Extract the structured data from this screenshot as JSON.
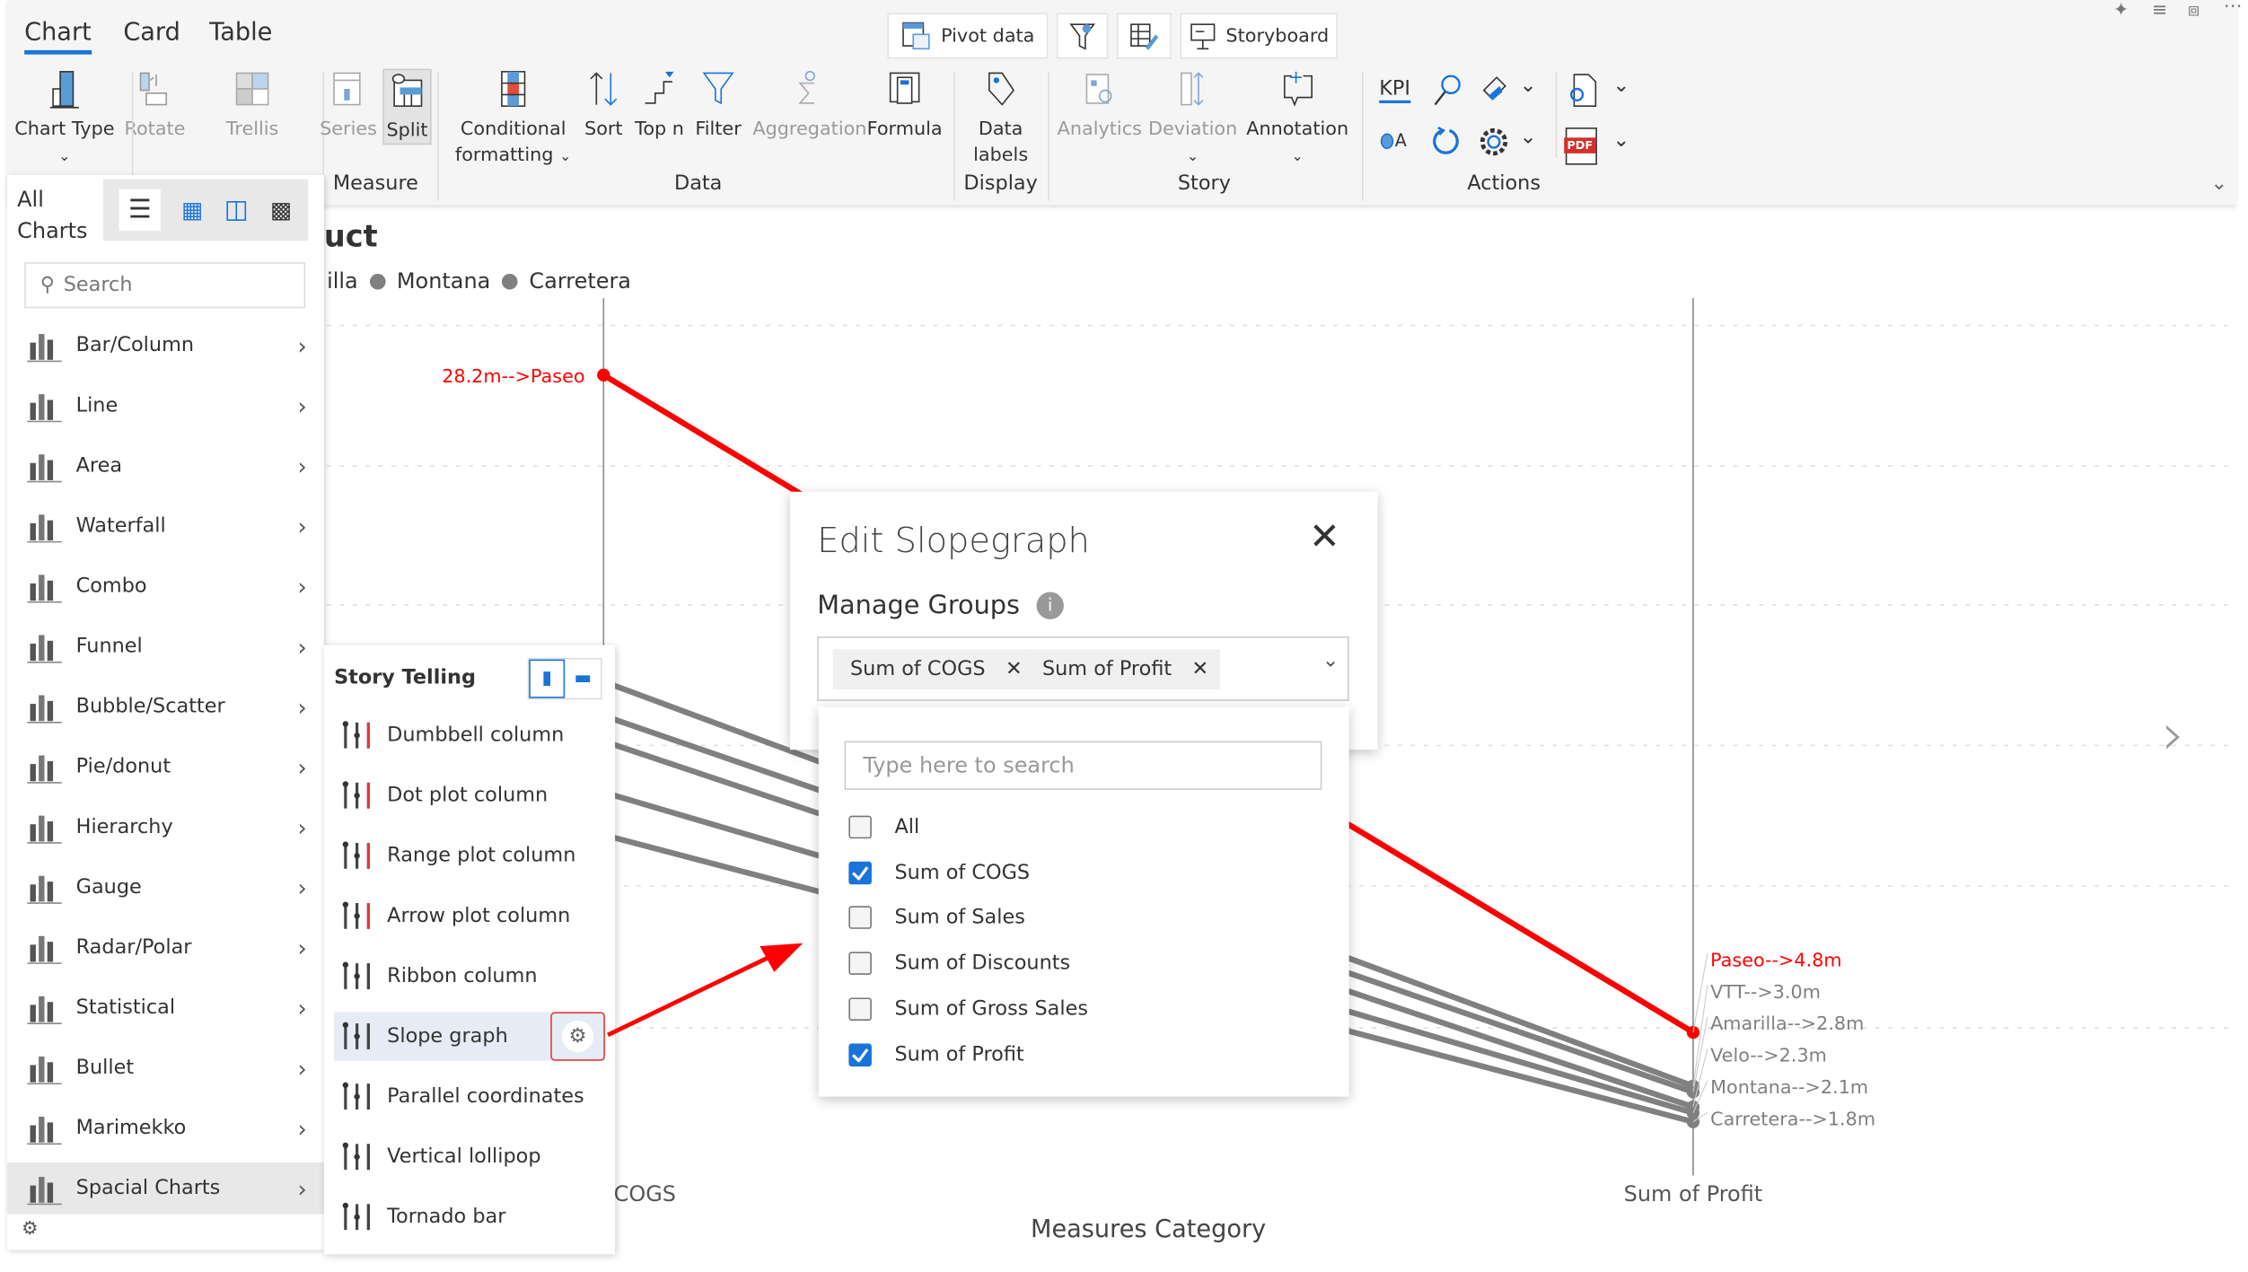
{
  "ribbon": {
    "tabs": [
      {
        "label": "Chart",
        "active": true
      },
      {
        "label": "Card"
      },
      {
        "label": "Table"
      }
    ],
    "top_buttons": {
      "pivot": "Pivot data",
      "storyboard": "Storyboard"
    },
    "buttons": {
      "chart_type": "Chart Type",
      "rotate": "Rotate",
      "trellis": "Trellis",
      "series": "Series",
      "split": "Split",
      "conditional_formatting": "Conditional formatting",
      "sort": "Sort",
      "top_n": "Top n",
      "filter": "Filter",
      "aggregation": "Aggregation",
      "formula": "Formula",
      "data_labels": "Data labels",
      "analytics": "Analytics",
      "deviation": "Deviation",
      "annotation": "Annotation",
      "kpi": "KPI",
      "oa": "A",
      "pdf": "PDF"
    },
    "groups": {
      "measure": "Measure",
      "data": "Data",
      "display": "Display",
      "story": "Story",
      "actions": "Actions"
    },
    "accent_color": "#1a73d9"
  },
  "chart_panel": {
    "title": "All Charts",
    "search_placeholder": "Search",
    "items": [
      {
        "label": "Bar/Column",
        "icon": "bar-column-icon"
      },
      {
        "label": "Line",
        "icon": "line-chart-icon"
      },
      {
        "label": "Area",
        "icon": "area-chart-icon"
      },
      {
        "label": "Waterfall",
        "icon": "waterfall-icon"
      },
      {
        "label": "Combo",
        "icon": "combo-chart-icon"
      },
      {
        "label": "Funnel",
        "icon": "funnel-icon"
      },
      {
        "label": "Bubble/Scatter",
        "icon": "scatter-icon"
      },
      {
        "label": "Pie/donut",
        "icon": "pie-icon"
      },
      {
        "label": "Hierarchy",
        "icon": "hierarchy-icon"
      },
      {
        "label": "Gauge",
        "icon": "gauge-icon"
      },
      {
        "label": "Radar/Polar",
        "icon": "radar-icon"
      },
      {
        "label": "Statistical",
        "icon": "statistical-icon"
      },
      {
        "label": "Bullet",
        "icon": "bullet-icon"
      },
      {
        "label": "Marimekko",
        "icon": "marimekko-icon"
      },
      {
        "label": "Spacial Charts",
        "icon": "spacial-charts-icon",
        "selected": true
      }
    ]
  },
  "story_panel": {
    "title": "Story Telling",
    "items": [
      "Dumbbell column",
      "Dot plot column",
      "Range plot column",
      "Arrow plot column",
      "Ribbon column",
      "Slope graph",
      "Parallel coordinates",
      "Vertical lollipop",
      "Tornado bar"
    ],
    "selected": "Slope graph"
  },
  "dialog": {
    "title": "Edit Slopegraph",
    "section": "Manage Groups",
    "chips": [
      "Sum of COGS",
      "Sum of Profit"
    ],
    "search_placeholder": "Type here to search",
    "options": [
      {
        "label": "All",
        "checked": false
      },
      {
        "label": "Sum of COGS",
        "checked": true
      },
      {
        "label": "Sum of Sales",
        "checked": false
      },
      {
        "label": "Sum of Discounts",
        "checked": false
      },
      {
        "label": "Sum of Gross Sales",
        "checked": false
      },
      {
        "label": "Sum of Profit",
        "checked": true
      }
    ]
  },
  "chart_data": {
    "type": "line",
    "title_visible": "uct",
    "legend_visible": [
      "illa",
      "Montana",
      "Carretera"
    ],
    "categories": [
      "Sum of COGS",
      "Sum of Profit"
    ],
    "xlabel": "Measures Category",
    "highlight_color": "#ff0000",
    "base_color": "#808080",
    "series": [
      {
        "name": "Paseo",
        "values": [
          28.2,
          4.8
        ],
        "highlight": true,
        "left_label": "28.2m-->Paseo",
        "right_label": "Paseo-->4.8m"
      },
      {
        "name": "VTT",
        "values": [
          17.4,
          3.0
        ],
        "right_label": "VTT-->3.0m"
      },
      {
        "name": "Amarilla",
        "values": [
          16.2,
          2.8
        ],
        "right_label": "Amarilla-->2.8m"
      },
      {
        "name": "Velo",
        "values": [
          15.3,
          2.3
        ],
        "right_label": "Velo-->2.3m"
      },
      {
        "name": "Montana",
        "values": [
          13.5,
          2.1
        ],
        "right_label": "Montana-->2.1m"
      },
      {
        "name": "Carretera",
        "values": [
          12.0,
          1.8
        ],
        "right_label": "Carretera-->1.8m"
      }
    ],
    "units": "m",
    "grid": true
  }
}
